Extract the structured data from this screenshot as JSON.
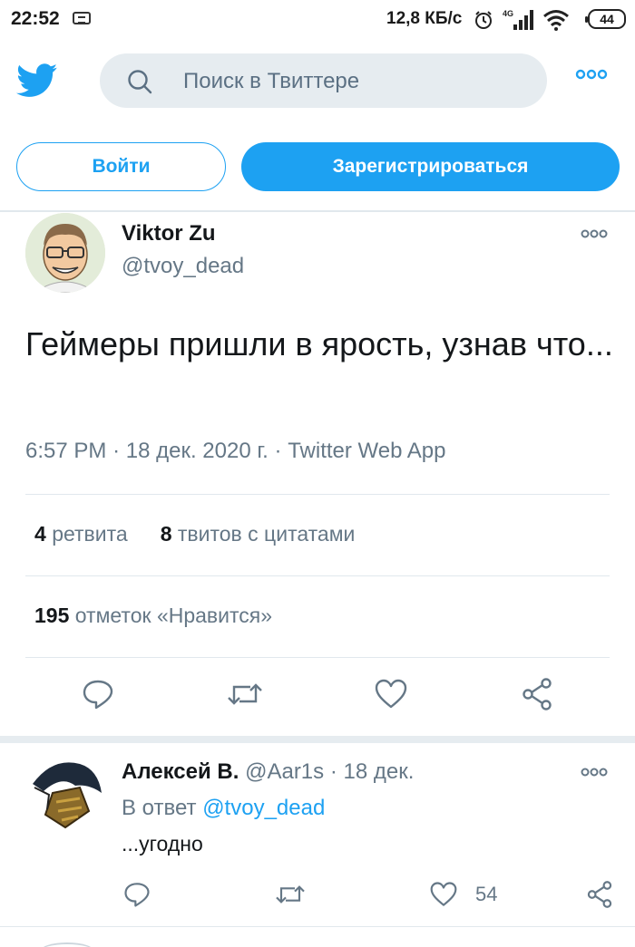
{
  "status_bar": {
    "time": "22:52",
    "net_speed": "12,8 КБ/с",
    "network_type": "4G",
    "battery": "44"
  },
  "header": {
    "search_placeholder": "Поиск в Твиттере"
  },
  "auth": {
    "login_label": "Войти",
    "signup_label": "Зарегистрироваться"
  },
  "tweet": {
    "author_name": "Viktor Zu",
    "author_handle": "@tvoy_dead",
    "text": "Геймеры пришли в ярость, узнав что...",
    "time": "6:57 PM",
    "date": "18 дек. 2020 г.",
    "source": "Twitter Web App",
    "retweets_count": "4",
    "retweets_label": "ретвита",
    "quotes_count": "8",
    "quotes_label": "твитов с цитатами",
    "likes_count": "195",
    "likes_label": "отметок «Нравится»"
  },
  "reply": {
    "author_name": "Алексей В.",
    "author_handle": "@Aar1s",
    "date": "18 дек.",
    "reply_to_prefix": "В ответ",
    "reply_to_handle": "@tvoy_dead",
    "text": "...угодно",
    "likes_count": "54"
  },
  "colors": {
    "accent": "#1da1f2",
    "secondary_text": "#657786",
    "primary_text": "#14171a",
    "search_bg": "#e6ecf0"
  },
  "icons": [
    "cast-icon",
    "alarm-icon",
    "signal-icon",
    "wifi-icon",
    "battery-icon",
    "twitter-bird-icon",
    "search-icon",
    "more-icon",
    "reply-icon",
    "retweet-icon",
    "like-icon",
    "share-icon"
  ]
}
